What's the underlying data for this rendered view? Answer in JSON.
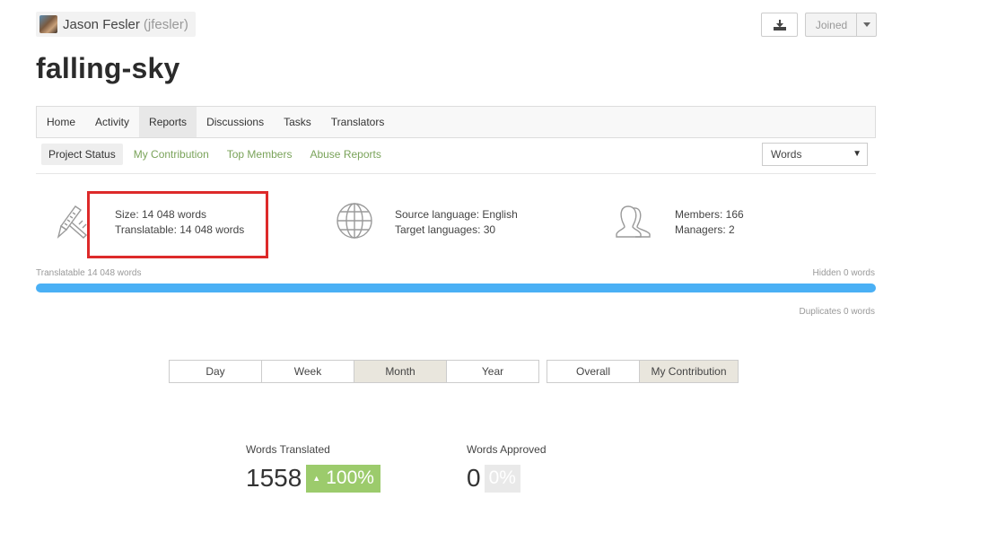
{
  "owner": {
    "name": "Jason Fesler",
    "handle": "(jfesler)"
  },
  "actions": {
    "joined_label": "Joined"
  },
  "project": {
    "title": "falling-sky"
  },
  "main_nav": [
    "Home",
    "Activity",
    "Reports",
    "Discussions",
    "Tasks",
    "Translators"
  ],
  "main_nav_active": "Reports",
  "sub_nav": [
    "Project Status",
    "My Contribution",
    "Top Members",
    "Abuse Reports"
  ],
  "sub_nav_active": "Project Status",
  "units_select": {
    "value": "Words"
  },
  "stats": {
    "size": "Size: 14 048 words",
    "translatable": "Translatable: 14 048 words",
    "source_language": "Source language: English",
    "target_languages": "Target languages: 30",
    "members": "Members: 166",
    "managers": "Managers: 2"
  },
  "bar": {
    "translatable_label": "Translatable 14 048 words",
    "hidden_label": "Hidden 0 words",
    "duplicates_label": "Duplicates 0 words",
    "translatable_fraction": 1.0
  },
  "periods": [
    "Day",
    "Week",
    "Month",
    "Year"
  ],
  "period_active": "Month",
  "scopes": [
    "Overall",
    "My Contribution"
  ],
  "scope_active": "My Contribution",
  "results": {
    "translated_label": "Words Translated",
    "translated_value": "1558",
    "translated_pct": "100%",
    "approved_label": "Words Approved",
    "approved_value": "0",
    "approved_pct": "0%"
  },
  "colors": {
    "accent_green": "#9ccb6c",
    "link_green": "#7aa35a",
    "progress_blue": "#4ab0f5",
    "highlight_red": "#dd2a2a"
  }
}
